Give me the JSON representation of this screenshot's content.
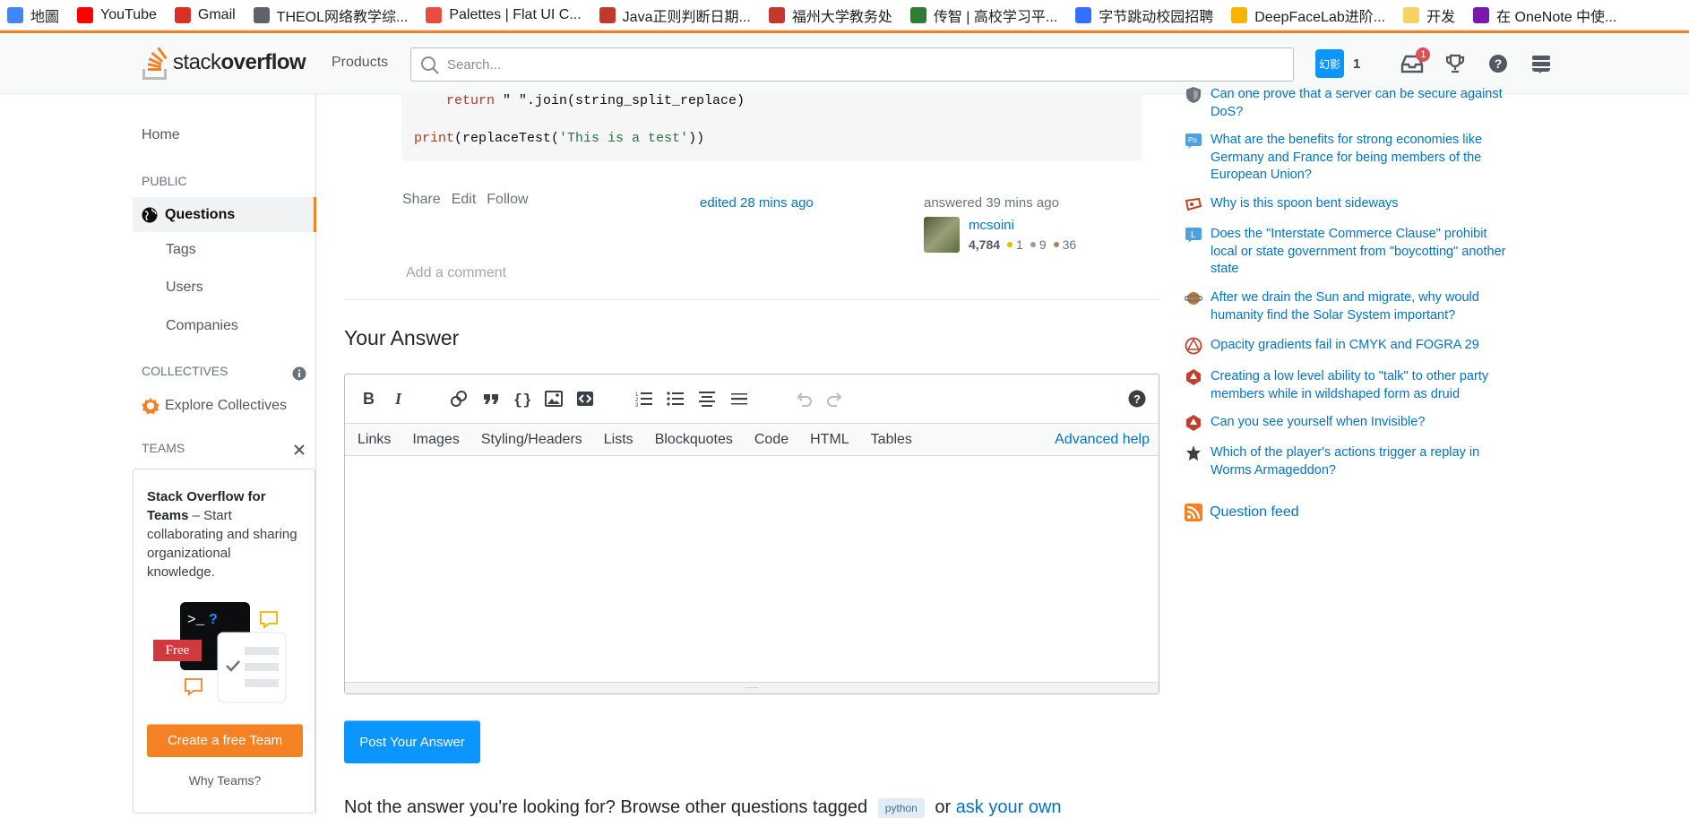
{
  "bookmarks": [
    {
      "label": "地圖",
      "color": "#4285f4"
    },
    {
      "label": "YouTube",
      "color": "#ff0000"
    },
    {
      "label": "Gmail",
      "color": "#d93025"
    },
    {
      "label": "THEOL网络教学综...",
      "color": "#5f6368"
    },
    {
      "label": "Palettes | Flat UI C...",
      "color": "#e74c3c"
    },
    {
      "label": "Java正则判断日期...",
      "color": "#c0392b"
    },
    {
      "label": "福州大学教务处",
      "color": "#c0392b"
    },
    {
      "label": "传智 | 高校学习平...",
      "color": "#2e7d32"
    },
    {
      "label": "字节跳动校园招聘",
      "color": "#3370ff"
    },
    {
      "label": "DeepFaceLab进阶...",
      "color": "#f4b400"
    },
    {
      "label": "开发",
      "color": "#f6d365"
    },
    {
      "label": "在 OneNote 中使...",
      "color": "#7719aa"
    }
  ],
  "header": {
    "logo_light": "stack",
    "logo_bold": "overflow",
    "products": "Products",
    "search_placeholder": "Search...",
    "avatar_text": "幻影",
    "reputation": "1",
    "inbox_count": "1"
  },
  "leftnav": {
    "home": "Home",
    "public": "PUBLIC",
    "questions": "Questions",
    "tags": "Tags",
    "users": "Users",
    "companies": "Companies",
    "collectives": "COLLECTIVES",
    "explore": "Explore Collectives",
    "teams": "TEAMS",
    "teams_title": "Stack Overflow for Teams",
    "teams_desc": " – Start collaborating and sharing organizational knowledge.",
    "free_badge": "Free",
    "create_team": "Create a free Team",
    "why_teams": "Why Teams?"
  },
  "code": {
    "line1_kw": "return",
    "line1_rest": " \" \".join(string_split_replace)",
    "line2_fn": "print",
    "line2_a": "(replaceTest(",
    "line2_str": "'This is a test'",
    "line2_b": "))"
  },
  "post": {
    "share": "Share",
    "edit": "Edit",
    "follow": "Follow",
    "edited": "edited 28 mins ago",
    "answered": "answered 39 mins ago",
    "user_name": "mcsoini",
    "user_rep": "4,784",
    "gold": "1",
    "silver": "9",
    "bronze": "36",
    "add_comment": "Add a comment"
  },
  "answer": {
    "heading": "Your Answer",
    "help_tabs": [
      "Links",
      "Images",
      "Styling/Headers",
      "Lists",
      "Blockquotes",
      "Code",
      "HTML",
      "Tables"
    ],
    "advanced_help": "Advanced help",
    "post_button": "Post Your Answer",
    "not_answer_prefix": "Not the answer you're looking for? Browse other questions tagged",
    "tag": "python",
    "or": "or",
    "ask_own": "ask your own"
  },
  "sidebar": {
    "hot_questions": [
      "Can one prove that a server can be secure against DoS?",
      "What are the benefits for strong economies like Germany and France for being members of the European Union?",
      "Why is this spoon bent sideways",
      "Does the \"Interstate Commerce Clause\" prohibit local or state government from \"boycotting\" another state",
      "After we drain the Sun and migrate, why would humanity find the Solar System important?",
      "Opacity gradients fail in CMYK and FOGRA 29",
      "Creating a low level ability to \"talk\" to other party members while in wildshaped form as druid",
      "Can you see yourself when Invisible?",
      "Which of the player's actions trigger a replay in Worms Armageddon?"
    ],
    "feed": "Question feed"
  }
}
